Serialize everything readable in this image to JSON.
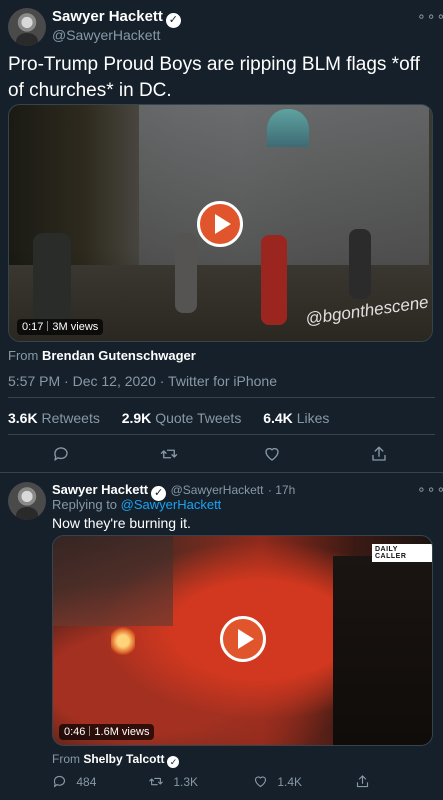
{
  "main_tweet": {
    "author_name": "Sawyer Hackett",
    "author_handle": "@SawyerHackett",
    "text": "Pro-Trump Proud Boys are ripping BLM flags *off of churches* in DC.",
    "video": {
      "duration": "0:17",
      "views": "3M views",
      "watermark": "@bgonthescene"
    },
    "from_label": "From",
    "from_name": "Brendan Gutenschwager",
    "timestamp": "5:57 PM · Dec 12, 2020 · Twitter for iPhone",
    "stats": {
      "retweets_count": "3.6K",
      "retweets_label": "Retweets",
      "quote_count": "2.9K",
      "quote_label": "Quote Tweets",
      "likes_count": "6.4K",
      "likes_label": "Likes"
    }
  },
  "reply_tweet": {
    "author_name": "Sawyer Hackett",
    "author_handle": "@SawyerHackett",
    "time": "· 17h",
    "replying_label": "Replying to",
    "replying_handle": "@SawyerHackett",
    "text": "Now they're burning it.",
    "video": {
      "duration": "0:46",
      "views": "1.6M views",
      "logo": "DAILY CALLER"
    },
    "from_label": "From",
    "from_name": "Shelby Talcott",
    "actions": {
      "replies": "484",
      "retweets": "1.3K",
      "likes": "1.4K"
    }
  },
  "more_glyph": "∘∘∘",
  "icons": [
    "more-icon",
    "verified-icon",
    "play-icon",
    "reply-icon",
    "retweet-icon",
    "like-icon",
    "share-icon"
  ],
  "colors": {
    "background": "#15202b",
    "muted": "#8899a6",
    "link": "#1da1f2",
    "play": "#e0552b",
    "divider": "#38444d"
  }
}
